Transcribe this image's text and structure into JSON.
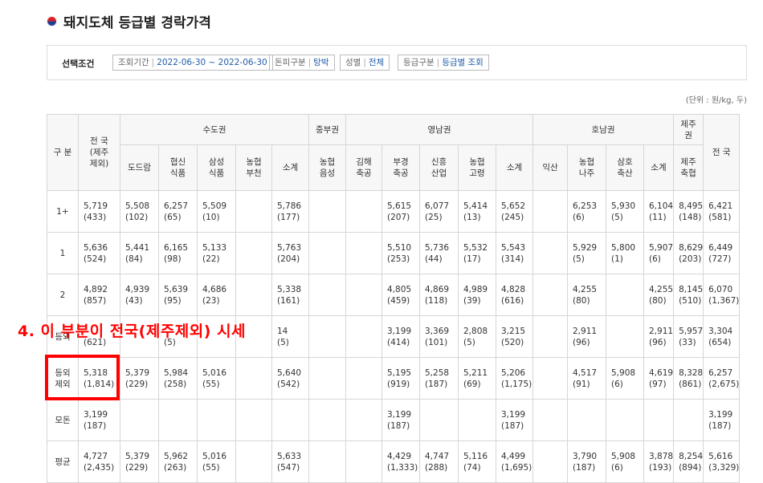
{
  "page": {
    "title": "돼지도체 등급별 경락가격"
  },
  "filter": {
    "title": "선택조건",
    "chips": [
      {
        "label": "조회기간",
        "value": "2022-06-30 ~ 2022-06-30"
      },
      {
        "label": "돈피구분",
        "value": "탕박"
      },
      {
        "label": "성별",
        "value": "전체"
      },
      {
        "label": "등급구분",
        "value": "등급별 조회"
      }
    ]
  },
  "unit": "(단위 : 원/kg, 두)",
  "table": {
    "header": {
      "gubun": "구 분",
      "jeonguk_ex": "전 국\n(제주\n제외)",
      "sudo": "수도권",
      "jungbu": "중부권",
      "yeongnam": "영남권",
      "honam": "호남권",
      "jeju": "제주\n권",
      "jeonguk": "전 국",
      "sub": [
        "도드람",
        "협신\n식품",
        "삼성\n식품",
        "농협\n부천",
        "소계",
        "농협\n음성",
        "김해\n축공",
        "부경\n축공",
        "신흥\n산업",
        "농협\n고령",
        "소계",
        "익산",
        "농협\n나주",
        "삼호\n축산",
        "소계",
        "제주\n축협"
      ]
    },
    "rows": [
      {
        "label": "1+",
        "cells": [
          "5,719\n(433)",
          "5,508\n(102)",
          "6,257\n(65)",
          "5,509\n(10)",
          "",
          "5,786\n(177)",
          "",
          "",
          "5,615\n(207)",
          "6,077\n(25)",
          "5,414\n(13)",
          "5,652\n(245)",
          "",
          "6,253\n(6)",
          "5,930\n(5)",
          "6,104\n(11)",
          "8,495\n(148)",
          "6,421\n(581)"
        ]
      },
      {
        "label": "1",
        "cells": [
          "5,636\n(524)",
          "5,441\n(84)",
          "6,165\n(98)",
          "5,133\n(22)",
          "",
          "5,763\n(204)",
          "",
          "",
          "5,510\n(253)",
          "5,736\n(44)",
          "5,532\n(17)",
          "5,543\n(314)",
          "",
          "5,929\n(5)",
          "5,800\n(1)",
          "5,907\n(6)",
          "8,629\n(203)",
          "6,449\n(727)"
        ]
      },
      {
        "label": "2",
        "cells": [
          "4,892\n(857)",
          "4,939\n(43)",
          "5,639\n(95)",
          "4,686\n(23)",
          "",
          "5,338\n(161)",
          "",
          "",
          "4,805\n(459)",
          "4,869\n(118)",
          "4,989\n(39)",
          "4,828\n(616)",
          "",
          "4,255\n(80)",
          "",
          "4,255\n(80)",
          "8,145\n(510)",
          "6,070\n(1,367)"
        ]
      },
      {
        "label": "등외",
        "cells": [
          "\n(621)",
          "",
          "\n(5)",
          "",
          "",
          "14\n(5)",
          "",
          "",
          "3,199\n(414)",
          "3,369\n(101)",
          "2,808\n(5)",
          "3,215\n(520)",
          "",
          "2,911\n(96)",
          "",
          "2,911\n(96)",
          "5,957\n(33)",
          "3,304\n(654)"
        ]
      },
      {
        "label": "등외\n제외",
        "cells": [
          "5,318\n(1,814)",
          "5,379\n(229)",
          "5,984\n(258)",
          "5,016\n(55)",
          "",
          "5,640\n(542)",
          "",
          "",
          "5,195\n(919)",
          "5,258\n(187)",
          "5,211\n(69)",
          "5,206\n(1,175)",
          "",
          "4,517\n(91)",
          "5,908\n(6)",
          "4,619\n(97)",
          "8,328\n(861)",
          "6,257\n(2,675)"
        ]
      },
      {
        "label": "모돈",
        "cells": [
          "3,199\n(187)",
          "",
          "",
          "",
          "",
          "",
          "",
          "",
          "3,199\n(187)",
          "",
          "",
          "3,199\n(187)",
          "",
          "",
          "",
          "",
          "",
          "3,199\n(187)"
        ]
      },
      {
        "label": "평균",
        "cells": [
          "4,727\n(2,435)",
          "5,379\n(229)",
          "5,962\n(263)",
          "5,016\n(55)",
          "",
          "5,633\n(547)",
          "",
          "",
          "4,429\n(1,333)",
          "4,747\n(288)",
          "5,116\n(74)",
          "4,499\n(1,695)",
          "",
          "3,790\n(187)",
          "5,908\n(6)",
          "3,878\n(193)",
          "8,254\n(894)",
          "5,616\n(3,329)"
        ]
      }
    ]
  },
  "annotation": "4. 이 부분이 전국(제주제외) 시세",
  "colors": {
    "annotation": "#ff0000",
    "link": "#1f5ca8",
    "header_bg": "#f7f7f7"
  }
}
